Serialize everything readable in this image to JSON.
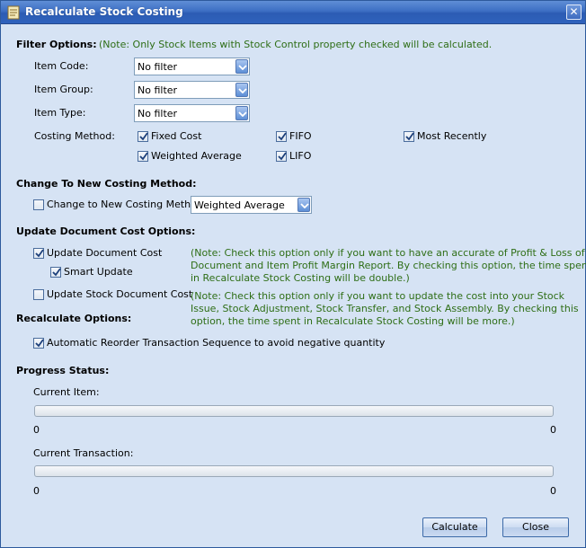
{
  "window": {
    "title": "Recalculate Stock Costing",
    "close_glyph": "✕"
  },
  "filter": {
    "heading": "Filter Options:",
    "note": "(Note: Only Stock Items with Stock Control property checked will be calculated.",
    "item_code_label": "Item Code:",
    "item_code_value": "No filter",
    "item_group_label": "Item Group:",
    "item_group_value": "No filter",
    "item_type_label": "Item Type:",
    "item_type_value": "No filter",
    "costing_method_label": "Costing Method:",
    "methods": {
      "fixed_cost": {
        "label": "Fixed Cost",
        "checked": true
      },
      "fifo": {
        "label": "FIFO",
        "checked": true
      },
      "most_recently": {
        "label": "Most Recently",
        "checked": true
      },
      "weighted_average": {
        "label": "Weighted Average",
        "checked": true
      },
      "lifo": {
        "label": "LIFO",
        "checked": true
      }
    }
  },
  "change_method": {
    "heading": "Change To New Costing Method:",
    "checkbox_label": "Change to New Costing Method",
    "checked": false,
    "selected": "Weighted Average"
  },
  "update_doc": {
    "heading": "Update Document Cost Options:",
    "update_document_cost_label": "Update Document Cost",
    "update_document_cost_checked": true,
    "smart_update_label": "Smart Update",
    "smart_update_checked": true,
    "note1_line1": "(Note: Check this option only if you want to have an accurate of Profit & Loss of",
    "note1_line2": "Document and Item Profit Margin Report. By checking this option, the time spent",
    "note1_line3": "in Recalculate Stock Costing will be double.)",
    "update_stock_doc_cost_label": "Update Stock Document Cost",
    "update_stock_doc_cost_checked": false,
    "note2_line1": "(Note: Check this option only if you want to update the cost into your Stock",
    "note2_line2": "Issue, Stock Adjustment, Stock Transfer, and Stock Assembly. By checking this",
    "note2_line3": "option, the time spent in Recalculate Stock Costing will be more.)"
  },
  "recalc": {
    "heading": "Recalculate Options:",
    "auto_reorder_label": "Automatic Reorder Transaction Sequence to avoid negative quantity",
    "auto_reorder_checked": true
  },
  "progress": {
    "heading": "Progress Status:",
    "current_item_label": "Current Item:",
    "current_item_min": "0",
    "current_item_max": "0",
    "current_item_fraction": 0,
    "current_txn_label": "Current Transaction:",
    "current_txn_min": "0",
    "current_txn_max": "0",
    "current_txn_fraction": 0
  },
  "buttons": {
    "calculate": "Calculate",
    "close": "Close"
  },
  "icons": {
    "window_icon": "document-icon",
    "dropdown": "chevron-down-icon",
    "check": "checkmark-icon"
  }
}
